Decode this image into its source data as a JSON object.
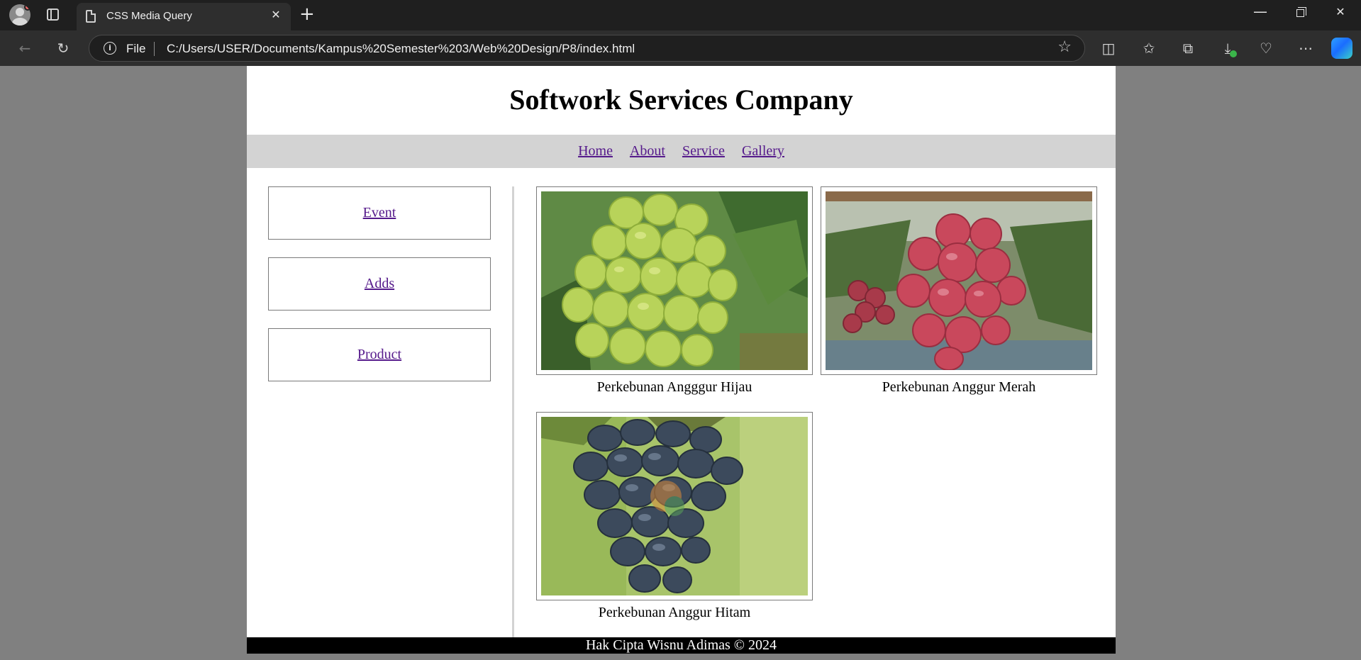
{
  "browser": {
    "tab_title": "CSS Media Query",
    "url_scheme_label": "File",
    "url": "C:/Users/USER/Documents/Kampus%20Semester%203/Web%20Design/P8/index.html"
  },
  "site": {
    "title": "Softwork Services Company",
    "nav": [
      "Home",
      "About",
      "Service",
      "Gallery"
    ],
    "sidebar": [
      "Event",
      "Adds",
      "Product"
    ],
    "gallery": [
      {
        "caption": "Perkebunan Angggur Hijau"
      },
      {
        "caption": "Perkebunan Anggur Merah"
      },
      {
        "caption": "Perkebunan Anggur Hitam"
      }
    ],
    "footer": "Hak Cipta Wisnu Adimas © 2024"
  },
  "colors": {
    "link": "#551a8b",
    "nav_bg": "#d3d3d3",
    "footer_bg": "#000000",
    "viewport_bg": "#808080"
  }
}
